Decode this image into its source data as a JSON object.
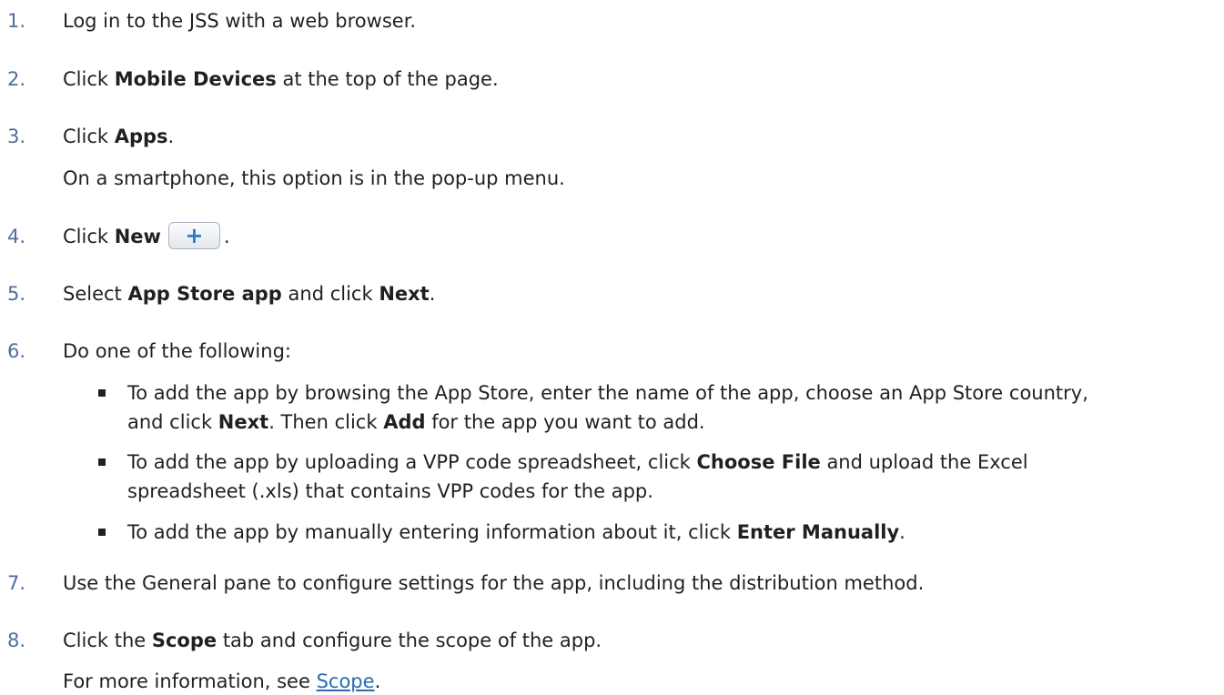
{
  "steps": [
    {
      "number": "1.",
      "text": "Log in to the JSS with a web browser."
    },
    {
      "number": "2.",
      "pre": "Click ",
      "bold": "Mobile Devices",
      "post": " at the top of the page."
    },
    {
      "number": "3.",
      "pre": "Click ",
      "bold": "Apps",
      "post": ".",
      "note": "On a smartphone, this option is in the pop-up menu."
    },
    {
      "number": "4.",
      "pre": "Click ",
      "bold": "New",
      "button_glyph": "+",
      "post": "."
    },
    {
      "number": "5.",
      "pre": "Select ",
      "bold1": "App Store app",
      "mid": " and click ",
      "bold2": "Next",
      "post": "."
    },
    {
      "number": "6.",
      "text": "Do one of the following:",
      "bullets": [
        {
          "line1_pre": "To add the app by browsing the App Store, enter the name of the app, choose an App Store country,",
          "line2_pre": "and click ",
          "line2_bold1": "Next",
          "line2_mid": ". Then click ",
          "line2_bold2": "Add",
          "line2_post": " for the app you want to add."
        },
        {
          "line1_pre": "To add the app by uploading a VPP code spreadsheet, click ",
          "line1_bold": "Choose File",
          "line1_post": " and upload the Excel",
          "line2": "spreadsheet (.xls) that contains VPP codes for the app."
        },
        {
          "pre": "To add the app by manually entering information about it, click ",
          "bold": "Enter Manually",
          "post": "."
        }
      ]
    },
    {
      "number": "7.",
      "text": "Use the General pane to configure settings for the app, including the distribution method."
    },
    {
      "number": "8.",
      "pre": "Click the ",
      "bold": "Scope",
      "post": " tab and configure the scope of the app.",
      "note_pre": "For more information, see ",
      "note_link": "Scope",
      "note_post": "."
    }
  ],
  "colors": {
    "number": "#4f6e9e",
    "text": "#231f20",
    "link": "#2a6bb0"
  }
}
